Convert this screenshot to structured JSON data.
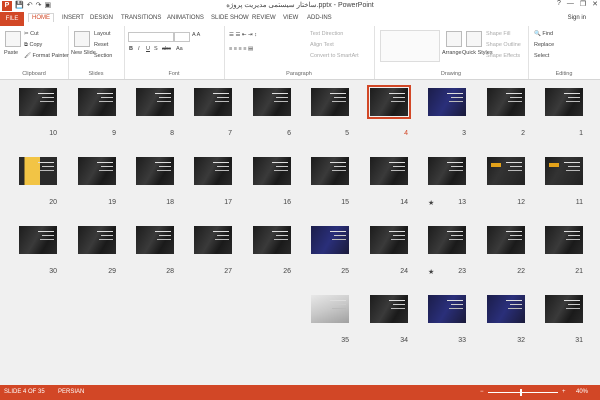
{
  "window": {
    "title": "ساختار سیستمی مدیریت پروژه.pptx - PowerPoint",
    "help_label": "?",
    "minimize_label": "—",
    "restore_label": "❐",
    "close_label": "✕"
  },
  "qat": {
    "logo_label": "P",
    "save_label": "💾",
    "undo_label": "↶",
    "redo_label": "↷",
    "present_label": "▣"
  },
  "tabs": [
    "FILE",
    "HOME",
    "INSERT",
    "DESIGN",
    "TRANSITIONS",
    "ANIMATIONS",
    "SLIDE SHOW",
    "REVIEW",
    "VIEW",
    "ADD-INS"
  ],
  "signin": "Sign in",
  "ribbon": {
    "clipboard": {
      "label": "Clipboard",
      "paste": "Paste",
      "cut": "Cut",
      "copy": "Copy",
      "format_painter": "Format Painter"
    },
    "slides": {
      "label": "Slides",
      "new_slide": "New Slide",
      "layout": "Layout",
      "reset": "Reset",
      "section": "Section"
    },
    "font": {
      "label": "Font",
      "size_value": "",
      "bold": "B",
      "italic": "I",
      "underline": "U",
      "strike": "S",
      "abc": "abc",
      "aa": "Aa"
    },
    "paragraph": {
      "label": "Paragraph",
      "text_direction": "Text Direction",
      "align_text": "Align Text",
      "convert": "Convert to SmartArt"
    },
    "drawing": {
      "label": "Drawing",
      "arrange": "Arrange",
      "quick_styles": "Quick Styles",
      "shape_fill": "Shape Fill",
      "shape_outline": "Shape Outline",
      "shape_effects": "Shape Effects"
    },
    "editing": {
      "label": "Editing",
      "find": "Find",
      "replace": "Replace",
      "select": "Select"
    }
  },
  "slides": [
    {
      "num": "10"
    },
    {
      "num": "9"
    },
    {
      "num": "8"
    },
    {
      "num": "7"
    },
    {
      "num": "6"
    },
    {
      "num": "5"
    },
    {
      "num": "4"
    },
    {
      "num": "3"
    },
    {
      "num": "2"
    },
    {
      "num": "1"
    },
    {
      "num": "20"
    },
    {
      "num": "19"
    },
    {
      "num": "18"
    },
    {
      "num": "17"
    },
    {
      "num": "16"
    },
    {
      "num": "15"
    },
    {
      "num": "14"
    },
    {
      "num": "13",
      "star": "★"
    },
    {
      "num": "12"
    },
    {
      "num": "11"
    },
    {
      "num": "30"
    },
    {
      "num": "29"
    },
    {
      "num": "28"
    },
    {
      "num": "27"
    },
    {
      "num": "26"
    },
    {
      "num": "25"
    },
    {
      "num": "24"
    },
    {
      "num": "23",
      "star": "★"
    },
    {
      "num": "22"
    },
    {
      "num": "21"
    },
    {
      "num": "35"
    },
    {
      "num": "34"
    },
    {
      "num": "33"
    },
    {
      "num": "32"
    },
    {
      "num": "31"
    }
  ],
  "status": {
    "slide_info": "SLIDE 4 OF 35",
    "language": "PERSIAN",
    "zoom": "40%",
    "zoom_minus": "−",
    "zoom_plus": "+",
    "selected_slide": "4",
    "colors": {
      "accent": "#d24726",
      "status_bg": "#d24726"
    }
  }
}
